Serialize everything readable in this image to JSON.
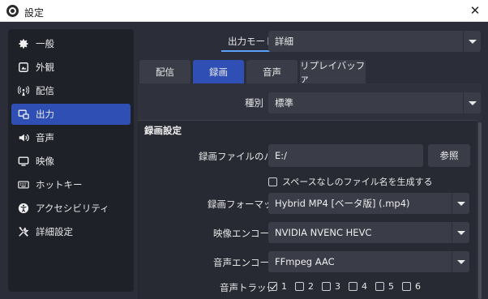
{
  "window": {
    "title": "設定",
    "close_glyph": "✕"
  },
  "sidebar": {
    "items": [
      {
        "label": "一般",
        "icon": "gear-icon"
      },
      {
        "label": "外観",
        "icon": "appearance-icon"
      },
      {
        "label": "配信",
        "icon": "broadcast-icon"
      },
      {
        "label": "出力",
        "icon": "output-icon",
        "active": true
      },
      {
        "label": "音声",
        "icon": "speaker-icon"
      },
      {
        "label": "映像",
        "icon": "monitor-icon"
      },
      {
        "label": "ホットキー",
        "icon": "keyboard-icon"
      },
      {
        "label": "アクセシビリティ",
        "icon": "accessibility-icon"
      },
      {
        "label": "詳細設定",
        "icon": "tools-icon"
      }
    ]
  },
  "output_mode": {
    "label": "出力モード",
    "value": "詳細"
  },
  "tabs": [
    {
      "label": "配信"
    },
    {
      "label": "録画",
      "active": true
    },
    {
      "label": "音声"
    },
    {
      "label": "リプレイバッファ"
    }
  ],
  "type": {
    "label": "種別",
    "value": "標準"
  },
  "recording": {
    "group_title": "録画設定",
    "path_label": "録画ファイルのパス",
    "path_value": "E:/",
    "browse_label": "参照",
    "no_space_label": "スペースなしのファイル名を生成する",
    "format_label": "録画フォーマット",
    "format_value": "Hybrid MP4 [ベータ版] (.mp4)",
    "video_encoder_label": "映像エンコーダ",
    "video_encoder_value": "NVIDIA NVENC HEVC",
    "audio_encoder_label": "音声エンコーダ",
    "audio_encoder_value": "FFmpeg AAC",
    "audio_track_label": "音声トラック",
    "tracks": [
      {
        "num": "1",
        "checked": true
      },
      {
        "num": "2",
        "checked": false
      },
      {
        "num": "3",
        "checked": false
      },
      {
        "num": "4",
        "checked": false
      },
      {
        "num": "5",
        "checked": false
      },
      {
        "num": "6",
        "checked": false
      }
    ]
  },
  "colors": {
    "accent": "#2f4fb5",
    "focus_underline": "#5aa0ff",
    "background": "#2b2e38"
  }
}
